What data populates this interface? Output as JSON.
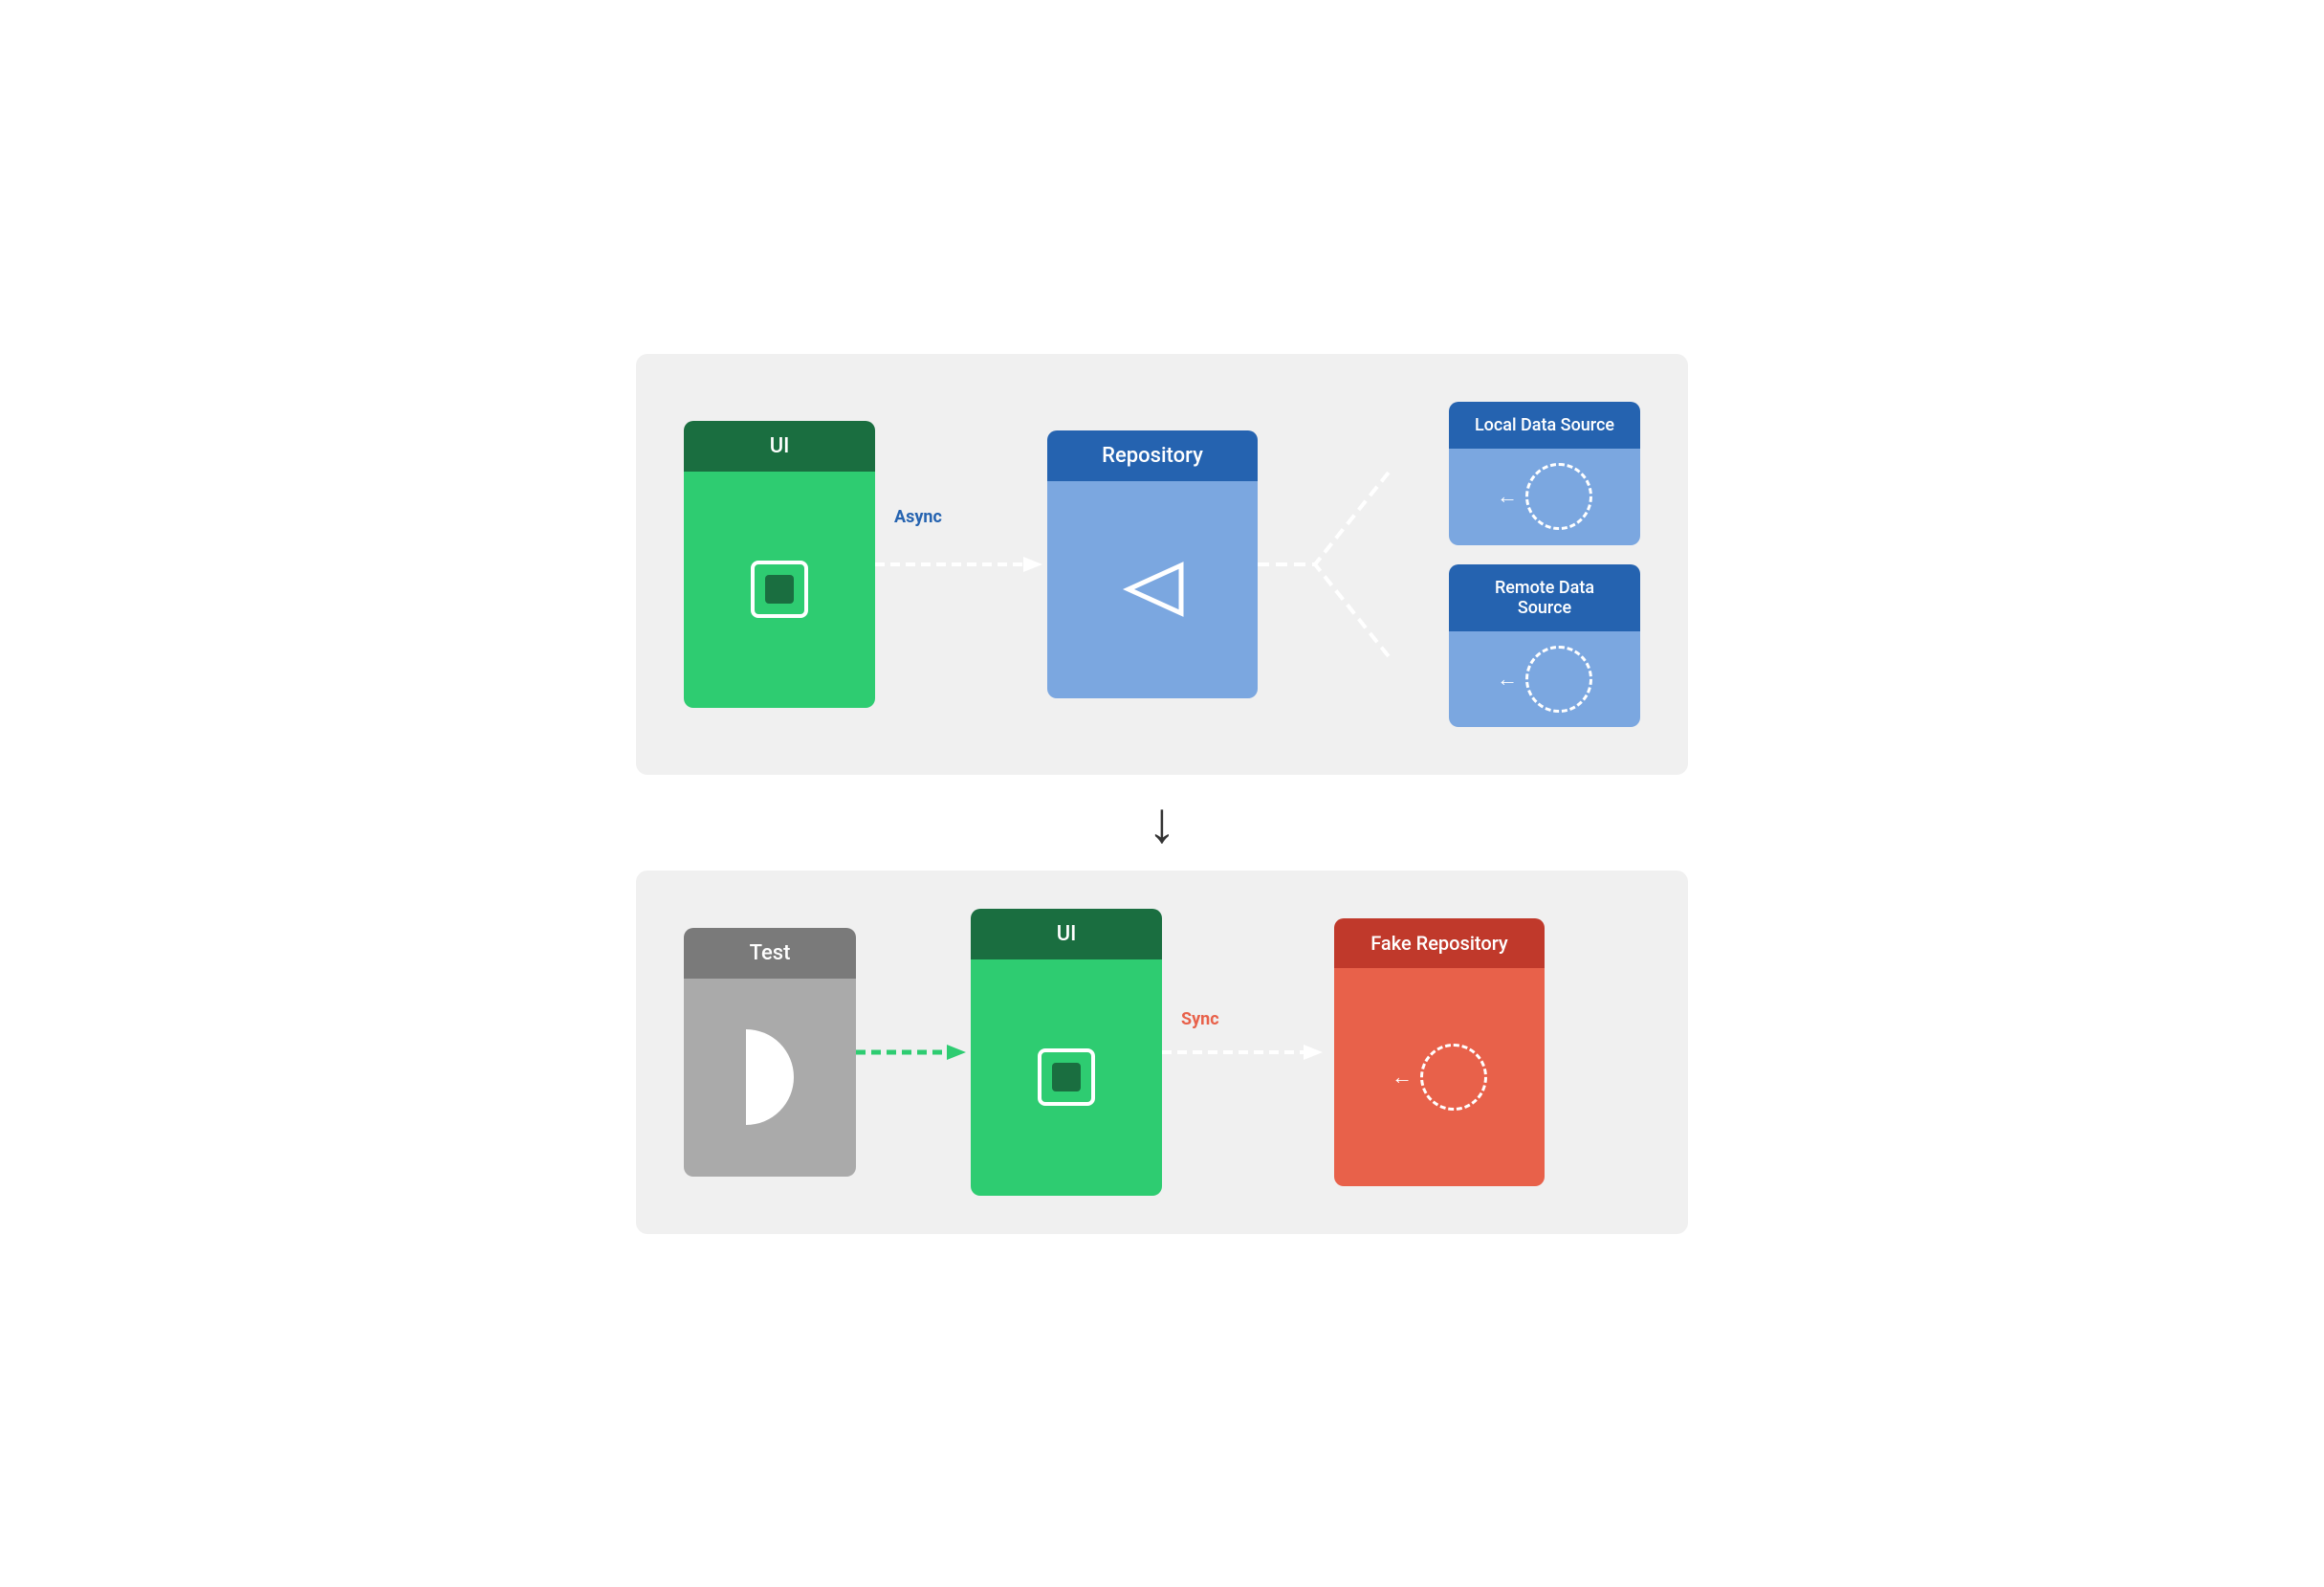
{
  "top_diagram": {
    "ui_label": "UI",
    "repo_label": "Repository",
    "local_ds_label": "Local Data Source",
    "remote_ds_label": "Remote Data Source",
    "async_label": "Async",
    "colors": {
      "ui_header": "#1a6e40",
      "ui_body": "#2ecc71",
      "repo_header": "#2563b0",
      "repo_body": "#7ba7e0",
      "ds_header": "#2563b0",
      "ds_body": "#7ba7e0"
    }
  },
  "bottom_diagram": {
    "test_label": "Test",
    "ui_label": "UI",
    "fake_repo_label": "Fake Repository",
    "sync_label": "Sync",
    "colors": {
      "test_header": "#7a7a7a",
      "test_body": "#aaaaaa",
      "ui_header": "#1a6e40",
      "ui_body": "#2ecc71",
      "fake_repo_header": "#c0392b",
      "fake_repo_body": "#e8614a"
    }
  },
  "arrow_down": "↓"
}
